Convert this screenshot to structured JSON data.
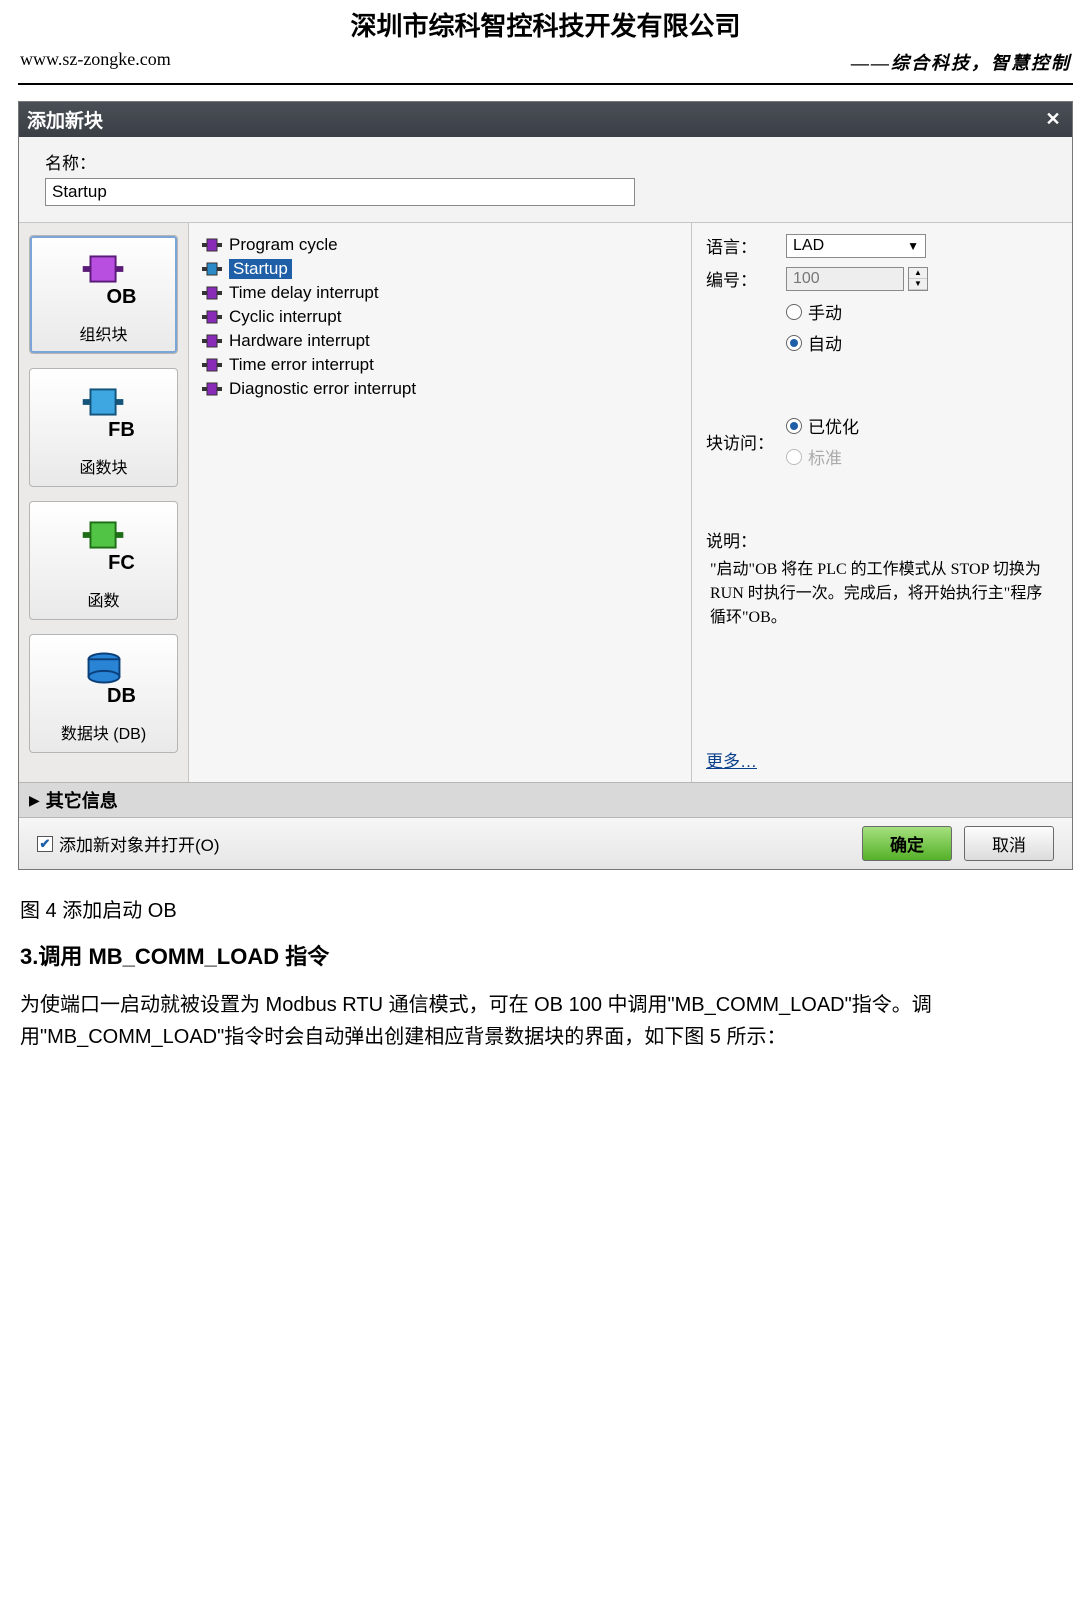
{
  "doc": {
    "company": "深圳市综科智控科技开发有限公司",
    "url": "www.sz-zongke.com",
    "slogan": "——综合科技，智慧控制",
    "caption": "图 4 添加启动 OB",
    "section_title": "3.调用 MB_COMM_LOAD 指令",
    "body_text": "为使端口一启动就被设置为 Modbus RTU 通信模式，可在 OB 100 中调用\"MB_COMM_LOAD\"指令。调用\"MB_COMM_LOAD\"指令时会自动弹出创建相应背景数据块的界面，如下图 5 所示："
  },
  "dialog": {
    "title": "添加新块",
    "name_label": "名称：",
    "name_value": "Startup",
    "blocks": [
      {
        "code": "OB",
        "label": "组织块",
        "color": "#8a2bb8"
      },
      {
        "code": "FB",
        "label": "函数块",
        "color": "#2e89c7"
      },
      {
        "code": "FC",
        "label": "函数",
        "color": "#34a233"
      },
      {
        "code": "DB",
        "label": "数据块 (DB)",
        "color": "#1770c7"
      }
    ],
    "tree": [
      {
        "label": "Program cycle",
        "color": "#8a2bb8"
      },
      {
        "label": "Startup",
        "color": "#2e89c7",
        "selected": true
      },
      {
        "label": "Time delay interrupt",
        "color": "#8a2bb8"
      },
      {
        "label": "Cyclic interrupt",
        "color": "#8a2bb8"
      },
      {
        "label": "Hardware interrupt",
        "color": "#8a2bb8"
      },
      {
        "label": "Time error interrupt",
        "color": "#8a2bb8"
      },
      {
        "label": "Diagnostic error interrupt",
        "color": "#8a2bb8"
      }
    ],
    "right": {
      "lang_label": "语言：",
      "lang_value": "LAD",
      "num_label": "编号：",
      "num_value": "100",
      "radio_manual": "手动",
      "radio_auto": "自动",
      "access_label": "块访问：",
      "radio_optimized": "已优化",
      "radio_standard": "标准",
      "desc_label": "说明：",
      "desc_text": "\"启动\"OB 将在 PLC 的工作模式从 STOP 切换为 RUN 时执行一次。完成后，将开始执行主\"程序循环\"OB。",
      "more": "更多…"
    },
    "other_info": "其它信息",
    "footer": {
      "open_after_add": "添加新对象并打开(O)",
      "ok": "确定",
      "cancel": "取消"
    }
  }
}
